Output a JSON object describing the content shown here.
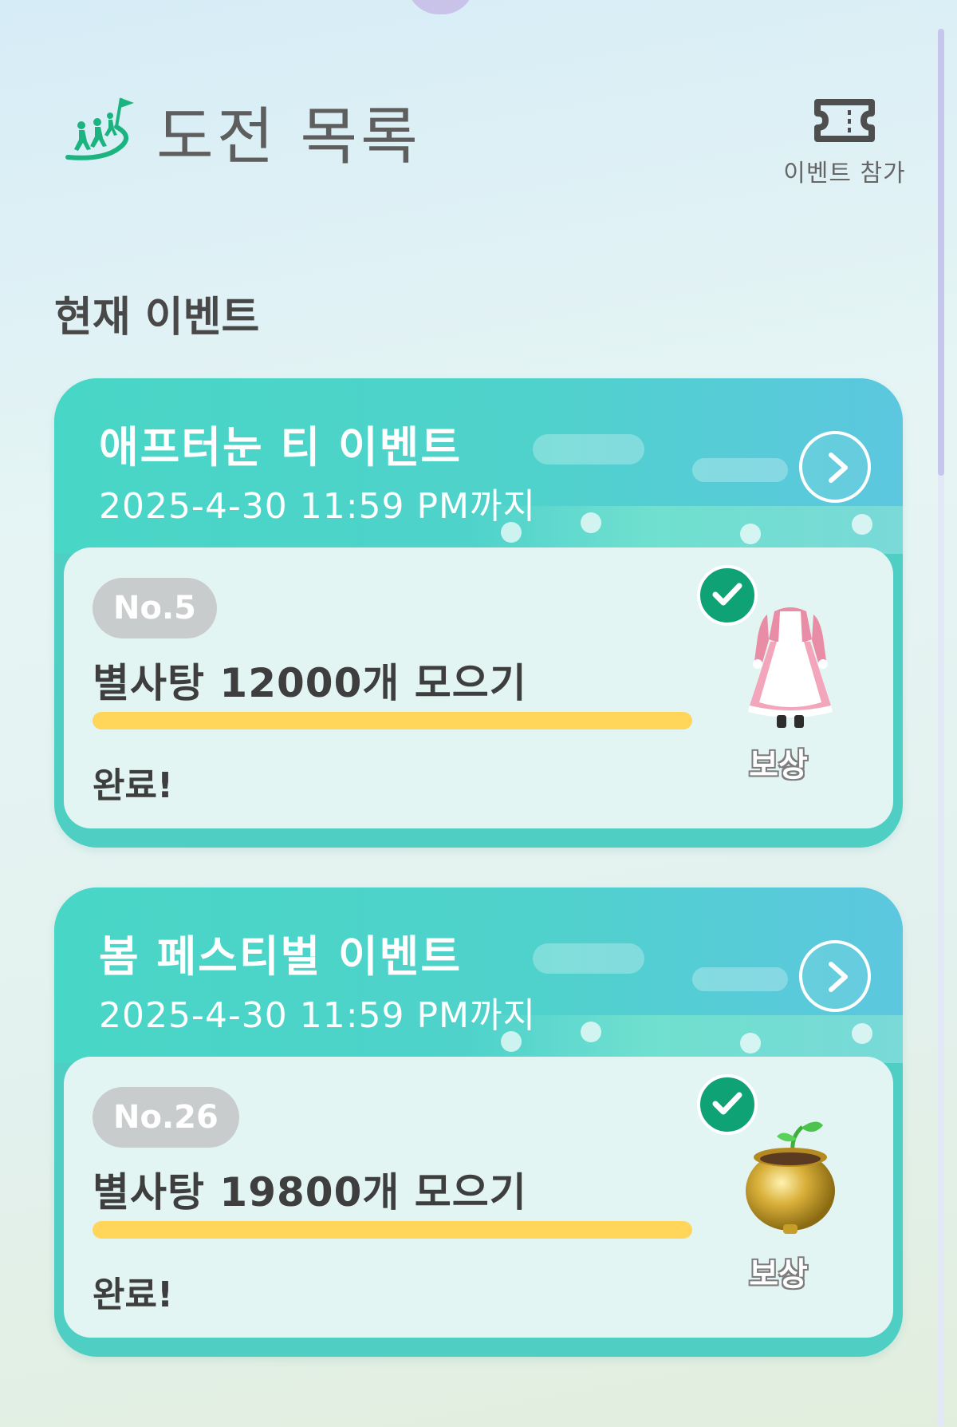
{
  "header": {
    "title": "도전 목록",
    "event_join_label": "이벤트 참가"
  },
  "section": {
    "title": "현재 이벤트"
  },
  "events": [
    {
      "name": "애프터눈 티 이벤트",
      "deadline": "2025-4-30 11:59 PM까지",
      "mission": {
        "number": "No.5",
        "title": "별사탕 12000개 모으기",
        "progress": 1.0,
        "status": "완료!",
        "completed": true,
        "reward_label": "보상",
        "reward_icon": "maid-outfit-icon"
      }
    },
    {
      "name": "봄 페스티벌 이벤트",
      "deadline": "2025-4-30 11:59 PM까지",
      "mission": {
        "number": "No.26",
        "title": "별사탕 19800개 모으기",
        "progress": 1.0,
        "status": "완료!",
        "completed": true,
        "reward_label": "보상",
        "reward_icon": "golden-pot-sprout-icon"
      }
    }
  ],
  "colors": {
    "card": "#4fcfc4",
    "progress": "#ffd65a",
    "check": "#0fa274"
  }
}
